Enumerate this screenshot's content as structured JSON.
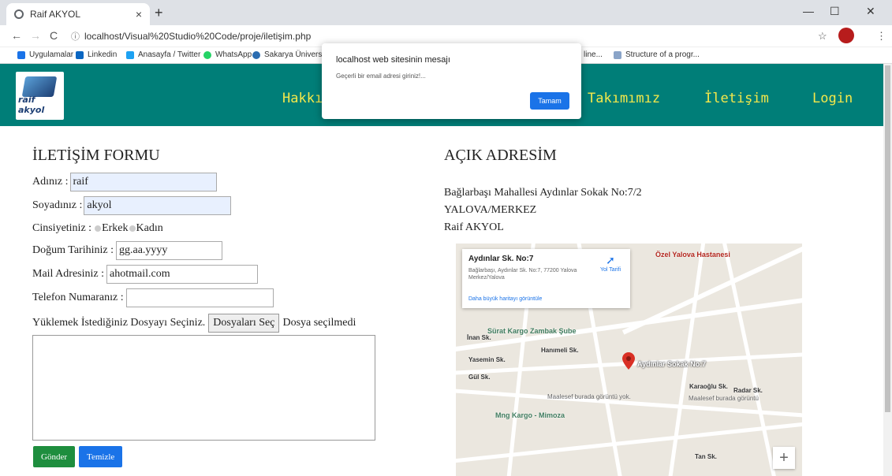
{
  "browser": {
    "tab_title": "Raif AKYOL",
    "tab_close": "×",
    "new_tab": "+",
    "url": "localhost/Visual%20Studio%20Code/proje/iletişim.php",
    "controls": {
      "minimize": "—",
      "maximize": "☐",
      "close": "✕"
    },
    "nav": {
      "back": "←",
      "forward": "→",
      "reload": "C"
    }
  },
  "bookmarks": [
    {
      "label": "Uygulamalar",
      "icon_color": "#1a73e8"
    },
    {
      "label": "Linkedin",
      "icon_color": "#0a66c2"
    },
    {
      "label": "Anasayfa / Twitter",
      "icon_color": "#1da1f2"
    },
    {
      "label": "WhatsApp",
      "icon_color": "#25d366"
    },
    {
      "label": "Sakarya Üniversi",
      "icon_color": "#2b6cb0"
    },
    {
      "label": "line...",
      "icon_color": "#ffffff"
    },
    {
      "label": "Structure of a progr...",
      "icon_color": "#8aa4c8"
    }
  ],
  "site": {
    "logo_text": "raif akyol",
    "nav": [
      "Hakkı",
      "Takımımız",
      "İletişim",
      "Login"
    ],
    "header_color": "#007e78",
    "nav_color": "#f5e84a"
  },
  "alert": {
    "title": "localhost web sitesinin mesajı",
    "message": "Geçerli bir email adresi giriniz!...",
    "ok_label": "Tamam"
  },
  "form": {
    "heading": "İLETİŞİM FORMU",
    "name_label": "Adınız :",
    "name_value": "raif",
    "surname_label": "Soyadınız :",
    "surname_value": "akyol",
    "gender_label": "Cinsiyetiniz :",
    "gender_male": "Erkek",
    "gender_female": "Kadın",
    "birth_label": "Doğum Tarihiniz :",
    "birth_value": "gg.aa.yyyy",
    "mail_label": "Mail Adresiniz :",
    "mail_value": "ahotmail.com",
    "phone_label": "Telefon Numaranız :",
    "phone_value": "",
    "file_label": "Yüklemek İstediğiniz Dosyayı Seçiniz.",
    "file_button": "Dosyaları Seç",
    "file_status": "Dosya seçilmedi",
    "submit_label": "Gönder",
    "reset_label": "Temizle"
  },
  "address": {
    "heading": "AÇIK ADRESİM",
    "line1": "Bağlarbaşı Mahallesi Aydınlar Sokak No:7/2",
    "line2": "YALOVA/MERKEZ",
    "line3": "Raif AKYOL"
  },
  "map": {
    "card_title": "Aydınlar Sk. No:7",
    "card_address": "Bağlarbaşı, Aydınlar Sk. No:7, 77200 Yalova Merkez/Yalova",
    "directions": "Yol Tarifi",
    "larger_map": "Daha büyük haritayı görüntüle",
    "zoom_in": "+",
    "labels": {
      "pin_label": "Aydınlar Sokak No:7",
      "surat": "Sürat Kargo Zambak Şube",
      "mng": "Mng Kargo - Mimoza",
      "ozel": "Özel Yalova Hastanesi",
      "inan": "İnan Sk.",
      "yasemin": "Yasemin Sk.",
      "hanimeli": "Hanımeli Sk.",
      "gul": "Gül Sk.",
      "karaoglu": "Karaoğlu Sk.",
      "radar": "Radar Sk.",
      "tan": "Tan Sk.",
      "maalesef1": "Maalesef burada görüntü yok.",
      "maalesef2": "Maalesef burada görüntü"
    }
  }
}
